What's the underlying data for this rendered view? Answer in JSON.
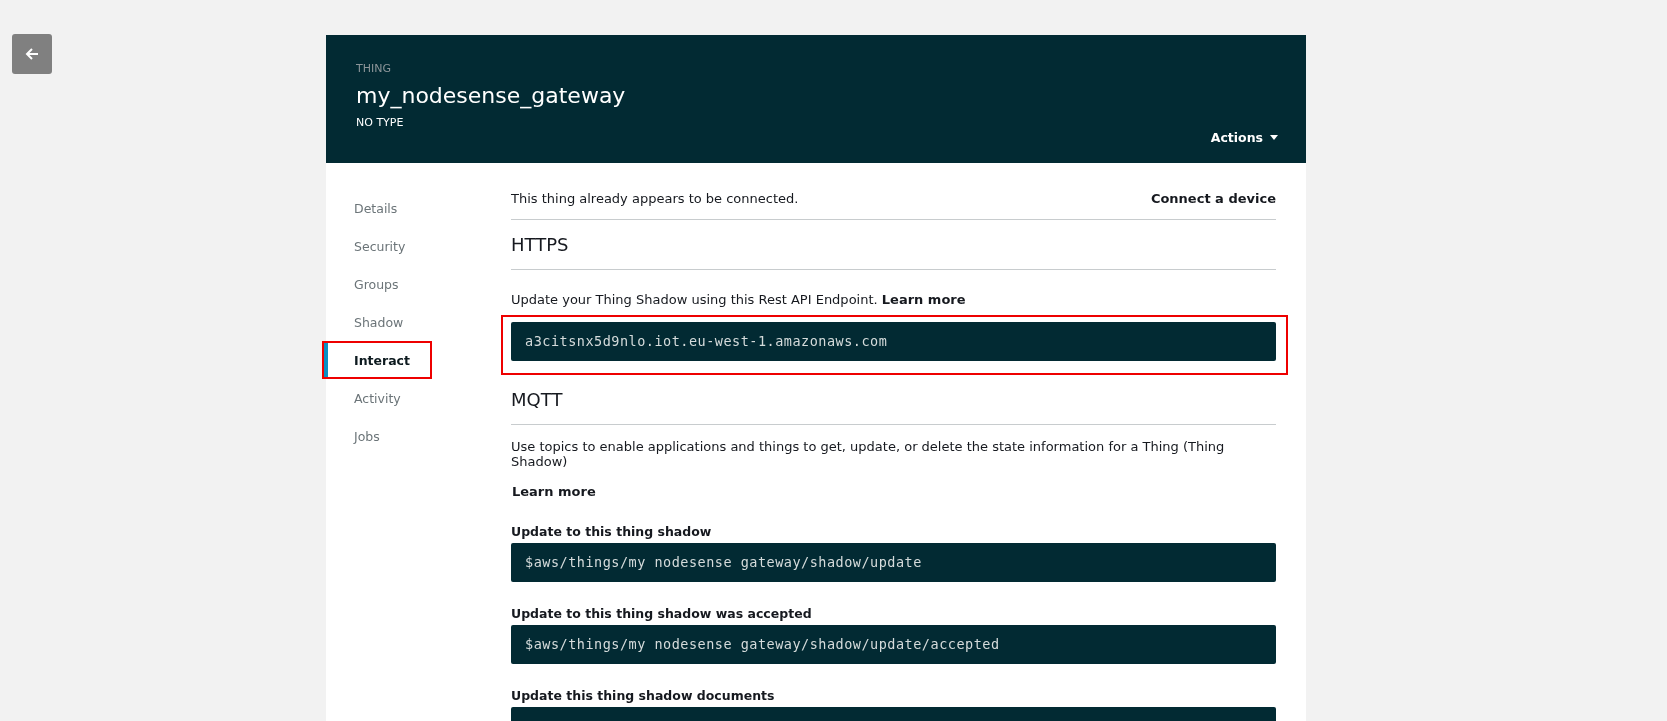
{
  "header": {
    "eyebrow": "THING",
    "title": "my_nodesense_gateway",
    "subtitle": "NO TYPE",
    "actions_label": "Actions"
  },
  "sidebar": {
    "items": [
      {
        "label": "Details",
        "selected": false,
        "highlighted": false
      },
      {
        "label": "Security",
        "selected": false,
        "highlighted": false
      },
      {
        "label": "Groups",
        "selected": false,
        "highlighted": false
      },
      {
        "label": "Shadow",
        "selected": false,
        "highlighted": false
      },
      {
        "label": "Interact",
        "selected": true,
        "highlighted": true
      },
      {
        "label": "Activity",
        "selected": false,
        "highlighted": false
      },
      {
        "label": "Jobs",
        "selected": false,
        "highlighted": false
      }
    ]
  },
  "status": {
    "message": "This thing already appears to be connected.",
    "link": "Connect a device"
  },
  "https": {
    "heading": "HTTPS",
    "intro": "Update your Thing Shadow using this Rest API Endpoint.",
    "link": "Learn more",
    "endpoint": "a3citsnx5d9nlo.iot.eu-west-1.amazonaws.com",
    "highlighted": true
  },
  "mqtt": {
    "heading": "MQTT",
    "description": "Use topics to enable applications and things to get, update, or delete the state information for a Thing (Thing Shadow)",
    "link": "Learn more",
    "topics": [
      {
        "label": "Update to this thing shadow",
        "value": "$aws/things/my nodesense gateway/shadow/update"
      },
      {
        "label": "Update to this thing shadow was accepted",
        "value": "$aws/things/my nodesense gateway/shadow/update/accepted"
      },
      {
        "label": "Update this thing shadow documents"
      }
    ]
  }
}
